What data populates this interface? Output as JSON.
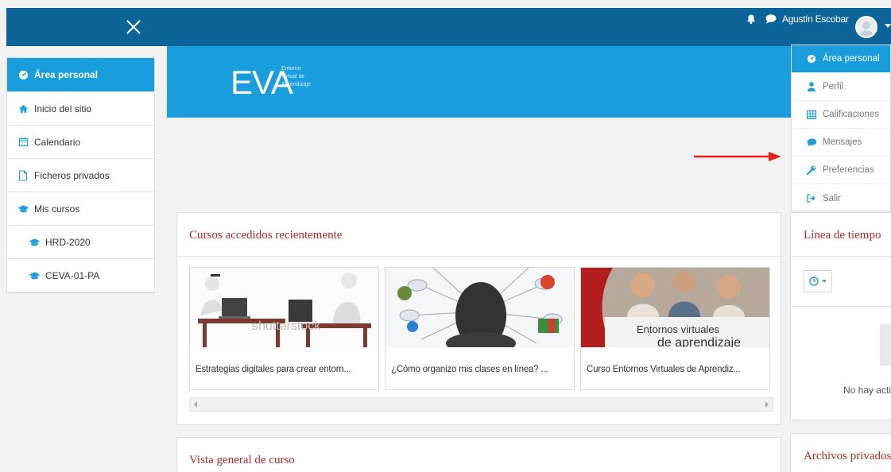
{
  "header": {
    "username": "Agustín Escobar",
    "brand_color": "#0d6499"
  },
  "sidebar": {
    "items": [
      {
        "label": "Área personal",
        "icon": "dashboard-icon",
        "active": true
      },
      {
        "label": "Inicio del sitio",
        "icon": "home-icon"
      },
      {
        "label": "Calendario",
        "icon": "calendar-icon"
      },
      {
        "label": "Ficheros privados",
        "icon": "file-icon"
      },
      {
        "label": "Mis cursos",
        "icon": "graduation-cap-icon"
      },
      {
        "label": "HRD-2020",
        "icon": "graduation-cap-icon"
      },
      {
        "label": "CEVA-01-PA",
        "icon": "graduation-cap-icon"
      }
    ]
  },
  "banner": {
    "logo_text": "EVA",
    "logo_sub": [
      "Entorno",
      "Virtual de",
      "Aprendizaje"
    ],
    "color": "#1a9ddc"
  },
  "recent": {
    "title": "Cursos accedidos recientemente",
    "courses": [
      {
        "name": "Estrategias digitales para crear entorn...",
        "image_text": "shutterstock"
      },
      {
        "name": "¿Cómo organizo mis clases en línea? ..."
      },
      {
        "name": "Curso Entornos Virtuales de Aprendiz...",
        "image_text": [
          "Entornos virtuales",
          "de aprendizaje"
        ]
      }
    ]
  },
  "overview": {
    "title": "Vista general de curso"
  },
  "timeline": {
    "title": "Línea de tiempo",
    "empty": "No hay activ"
  },
  "files": {
    "title": "Archivos privados"
  },
  "user_menu": {
    "items": [
      {
        "label": "Área personal",
        "icon": "dashboard-icon",
        "active": true
      },
      {
        "label": "Perfil",
        "icon": "user-icon"
      },
      {
        "label": "Calificaciones",
        "icon": "table-icon"
      },
      {
        "label": "Mensajes",
        "icon": "comment-icon"
      },
      {
        "label": "Preferencias",
        "icon": "wrench-icon"
      },
      {
        "label": "Salir",
        "icon": "sign-out-icon"
      }
    ]
  },
  "annotation_color": "#e8201c"
}
